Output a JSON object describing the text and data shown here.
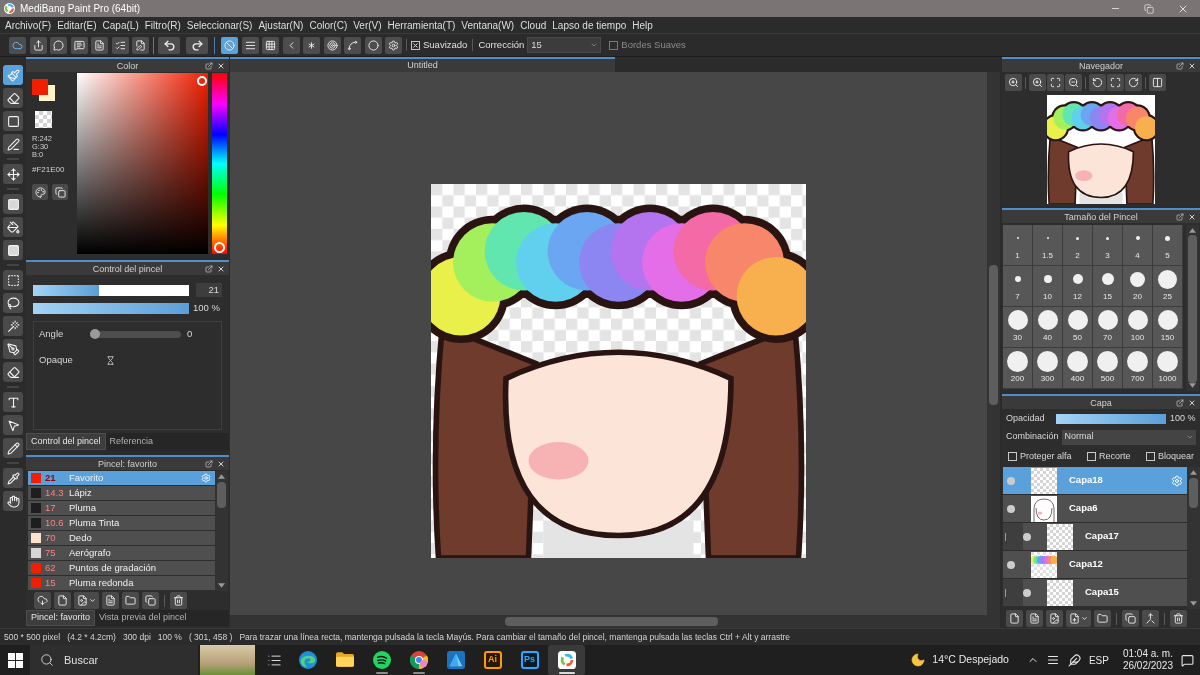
{
  "window": {
    "title": "MediBang Paint Pro (64bit)"
  },
  "menu": [
    "Archivo(F)",
    "Editar(E)",
    "Capa(L)",
    "Filtro(R)",
    "Seleccionar(S)",
    "Ajustar(N)",
    "Color(C)",
    "Ver(V)",
    "Herramienta(T)",
    "Ventana(W)",
    "Cloud",
    "Lapso de tiempo",
    "Help"
  ],
  "toolbar": {
    "snaps": [
      {
        "selected": true
      },
      {
        "selected": false
      },
      {
        "selected": false
      },
      {
        "selected": false
      },
      {
        "selected": false
      },
      {
        "selected": false
      },
      {
        "selected": false
      },
      {
        "selected": false
      },
      {
        "selected": false
      }
    ],
    "smoothing": {
      "label": "Suavizado",
      "checked": true,
      "disabled": false
    },
    "correction": {
      "label": "Corrección",
      "value": "15"
    },
    "soft_edges": {
      "label": "Bordes Suaves",
      "checked": false,
      "disabled": true
    }
  },
  "tools": [
    {
      "selected": true
    },
    {
      "selected": false
    },
    {
      "selected": false
    },
    {
      "selected": false
    },
    {
      "selected": false
    },
    {
      "selected": false
    },
    {
      "selected": false
    },
    {
      "selected": false
    },
    {
      "selected": false
    },
    {
      "selected": false
    },
    {
      "selected": false
    },
    {
      "selected": false
    },
    {
      "selected": false
    },
    {
      "selected": false
    },
    {
      "selected": false
    },
    {
      "selected": false
    },
    {
      "selected": false
    },
    {
      "selected": false
    }
  ],
  "color_panel": {
    "title": "Color",
    "swatches": [
      {
        "kind": "foreground",
        "color": "#f21e00"
      },
      {
        "kind": "background",
        "color": "#fff4c8"
      }
    ],
    "channels": [
      "R:242",
      "G:30",
      "B:0"
    ],
    "hex": "#F21E00"
  },
  "brush_control": {
    "title": "Control del pincel",
    "size": {
      "level": 0.42,
      "value": "21"
    },
    "opacity": {
      "level": 1,
      "value": "100 %"
    },
    "angle": {
      "label": "Angle",
      "level": 0,
      "value": "0"
    },
    "opaque": {
      "label": "Opaque"
    },
    "tabs": [
      {
        "label": "Control del pincel",
        "selected": true
      },
      {
        "label": "Referencia",
        "selected": false
      }
    ]
  },
  "brushes": {
    "title": "Pincel: favorito",
    "items": [
      {
        "color": "#f21e00",
        "size": "21",
        "name": "Favorito",
        "selected": true
      },
      {
        "color": "#1e1e1e",
        "size": "14.3",
        "name": "Lápiz",
        "selected": false
      },
      {
        "color": "#1e1e1e",
        "size": "17",
        "name": "Pluma",
        "selected": false
      },
      {
        "color": "#1e1e1e",
        "size": "10.6",
        "name": "Pluma Tinta",
        "selected": false
      },
      {
        "color": "#fde2cf",
        "size": "70",
        "name": "Dedo",
        "selected": false
      },
      {
        "color": "#d6d6d6",
        "size": "75",
        "name": "Aerógrafo",
        "selected": false
      },
      {
        "color": "#f21e00",
        "size": "62",
        "name": "Puntos de gradación",
        "selected": false
      },
      {
        "color": "#f21e00",
        "size": "15",
        "name": "Pluma redonda",
        "selected": false
      }
    ],
    "tabs": [
      {
        "label": "Pincel: favorito",
        "selected": true
      },
      {
        "label": "Vista previa del pincel",
        "selected": false
      }
    ]
  },
  "canvas": {
    "tab": "Untitled"
  },
  "navigator": {
    "title": "Navegador"
  },
  "brush_size": {
    "title": "Tamaño del Pincel",
    "sizes": [
      "1",
      "1.5",
      "2",
      "3",
      "4",
      "5",
      "7",
      "10",
      "12",
      "15",
      "20",
      "25",
      "30",
      "40",
      "50",
      "70",
      "100",
      "150",
      "200",
      "300",
      "400",
      "500",
      "700",
      "1000"
    ]
  },
  "layers": {
    "title": "Capa",
    "opacity": {
      "label": "Opacidad",
      "level": 1,
      "value": "100 %"
    },
    "blend": {
      "label": "Combinación",
      "value": "Normal"
    },
    "options": [
      {
        "label": "Proteger alfa",
        "checked": false
      },
      {
        "label": "Recorte",
        "checked": false
      },
      {
        "label": "Bloquear",
        "checked": false
      }
    ],
    "items": [
      {
        "name": "Capa18",
        "kind": "transparent",
        "selected": true,
        "visible": true,
        "clipped": false
      },
      {
        "name": "Capa6",
        "kind": "sketch",
        "selected": false,
        "visible": true,
        "clipped": false
      },
      {
        "name": "Capa17",
        "kind": "transparent",
        "selected": false,
        "visible": true,
        "clipped": true
      },
      {
        "name": "Capa12",
        "kind": "rainbow",
        "selected": false,
        "visible": true,
        "clipped": false
      },
      {
        "name": "Capa15",
        "kind": "transparent",
        "selected": false,
        "visible": true,
        "clipped": true
      }
    ]
  },
  "status_bar": {
    "document": [
      "500 * 500 pixel",
      "(4.2 * 4.2cm)",
      "300 dpi",
      "100 %",
      "( 301, 458 )"
    ],
    "hint": "Para trazar una línea recta, mantenga pulsada la tecla Mayús. Para cambiar el tamaño del pincel, mantenga pulsada las teclas Ctrl + Alt y arrastre"
  },
  "taskbar": {
    "search": {
      "placeholder": "Buscar"
    },
    "apps": [
      {
        "kind": "swirl",
        "selected": false,
        "running": false
      },
      {
        "kind": "folder",
        "selected": false,
        "running": false
      },
      {
        "kind": "disc",
        "selected": false,
        "running": true
      },
      {
        "kind": "ring",
        "selected": false,
        "running": true
      },
      {
        "kind": "triangle",
        "selected": false,
        "running": false
      },
      {
        "kind": "tile",
        "label": "Ai",
        "color": "#ff9a00",
        "selected": false,
        "running": false
      },
      {
        "kind": "tile",
        "label": "Ps",
        "color": "#31a8ff",
        "selected": false,
        "running": false
      },
      {
        "kind": "paint",
        "selected": true,
        "running": true
      }
    ],
    "weather": "14°C Despejado",
    "language": "ESP",
    "time": "01:04 a. m.",
    "date": "26/02/2023"
  }
}
